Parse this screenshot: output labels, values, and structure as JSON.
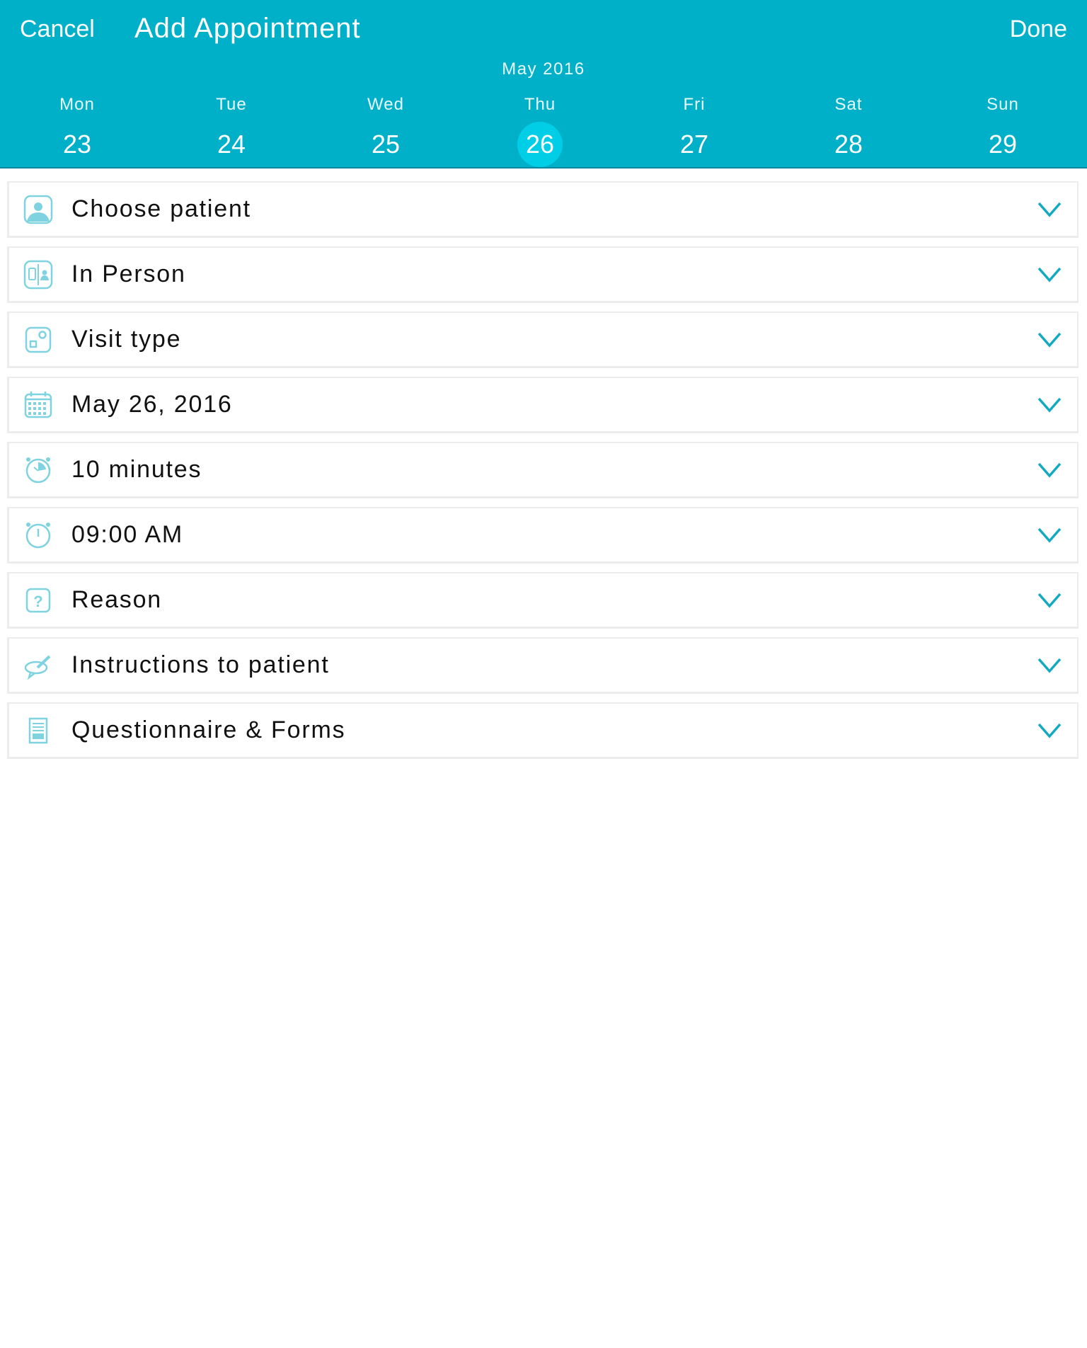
{
  "header": {
    "cancel_label": "Cancel",
    "title": "Add Appointment",
    "done_label": "Done",
    "month_label": "May 2016",
    "accent_color": "#00b0c8",
    "selected_color": "#00cde6"
  },
  "week": {
    "days": [
      {
        "name": "Mon",
        "num": "23",
        "selected": false
      },
      {
        "name": "Tue",
        "num": "24",
        "selected": false
      },
      {
        "name": "Wed",
        "num": "25",
        "selected": false
      },
      {
        "name": "Thu",
        "num": "26",
        "selected": true
      },
      {
        "name": "Fri",
        "num": "27",
        "selected": false
      },
      {
        "name": "Sat",
        "num": "28",
        "selected": false
      },
      {
        "name": "Sun",
        "num": "29",
        "selected": false
      }
    ]
  },
  "form": {
    "rows": [
      {
        "icon": "patient-icon",
        "label": "Choose patient"
      },
      {
        "icon": "in-person-icon",
        "label": "In Person"
      },
      {
        "icon": "visit-type-icon",
        "label": "Visit type"
      },
      {
        "icon": "calendar-icon",
        "label": "May 26, 2016"
      },
      {
        "icon": "duration-icon",
        "label": "10 minutes"
      },
      {
        "icon": "clock-icon",
        "label": "09:00 AM"
      },
      {
        "icon": "question-icon",
        "label": "Reason"
      },
      {
        "icon": "instructions-icon",
        "label": "Instructions to patient"
      },
      {
        "icon": "form-icon",
        "label": "Questionnaire & Forms"
      }
    ]
  }
}
